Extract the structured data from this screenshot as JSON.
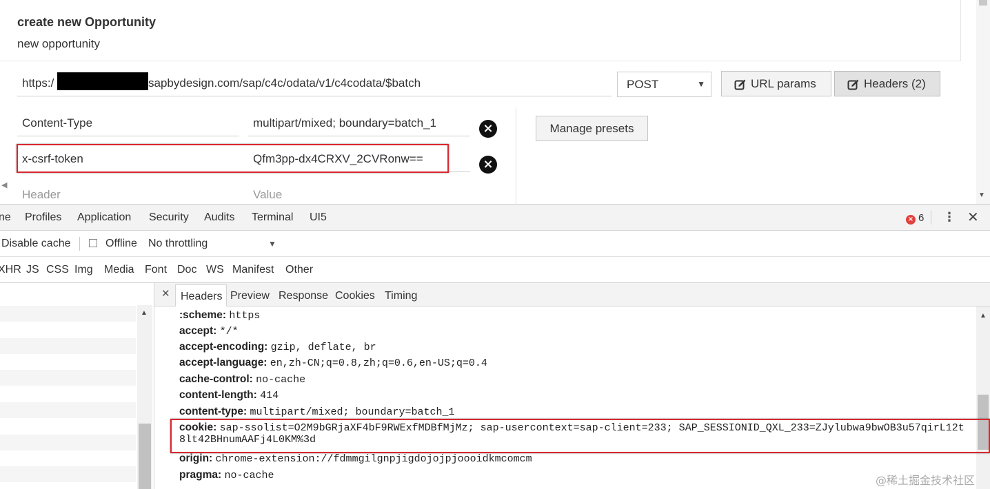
{
  "app": {
    "title": "create new Opportunity",
    "subtitle": "new opportunity",
    "url_prefix": "https:/",
    "url_rest": "sapbydesign.com/sap/c4c/odata/v1/c4codata/$batch",
    "method": "POST",
    "url_params_label": "URL params",
    "headers_button_label": "Headers (2)",
    "manage_presets_label": "Manage presets",
    "headers": [
      {
        "name": "Content-Type",
        "value": "multipart/mixed; boundary=batch_1"
      },
      {
        "name": "x-csrf-token",
        "value": "Qfm3pp-dx4CRXV_2CVRonw=="
      }
    ],
    "header_placeholder": "Header",
    "value_placeholder": "Value"
  },
  "devtools": {
    "tabs": [
      "ne",
      "Profiles",
      "Application",
      "Security",
      "Audits",
      "Terminal",
      "UI5"
    ],
    "error_count": "6",
    "toolbar": {
      "disable_cache": "Disable cache",
      "offline": "Offline",
      "throttling": "No throttling"
    },
    "filters": [
      "XHR",
      "JS",
      "CSS",
      "Img",
      "Media",
      "Font",
      "Doc",
      "WS",
      "Manifest",
      "Other"
    ],
    "detail_tabs": [
      "Headers",
      "Preview",
      "Response",
      "Cookies",
      "Timing"
    ],
    "request_headers": [
      {
        "key": ":scheme:",
        "value": "https"
      },
      {
        "key": "accept:",
        "value": "*/*"
      },
      {
        "key": "accept-encoding:",
        "value": "gzip, deflate, br"
      },
      {
        "key": "accept-language:",
        "value": "en,zh-CN;q=0.8,zh;q=0.6,en-US;q=0.4"
      },
      {
        "key": "cache-control:",
        "value": "no-cache"
      },
      {
        "key": "content-length:",
        "value": "414"
      },
      {
        "key": "content-type:",
        "value": "multipart/mixed; boundary=batch_1"
      },
      {
        "key": "cookie:",
        "value": "sap-ssolist=O2M9bGRjaXF4bF9RWExfMDBfMjMz; sap-usercontext=sap-client=233; SAP_SESSIONID_QXL_233=ZJylubwa9bwOB3u57qirL12t",
        "continuation": "8lt42BHnumAAFj4L0KM%3d"
      },
      {
        "key": "origin:",
        "value": "chrome-extension://fdmmgilgnpjigdojojpjoooidkmcomcm"
      },
      {
        "key": "pragma:",
        "value": "no-cache"
      }
    ]
  },
  "watermark": "@稀土掘金技术社区",
  "colors": {
    "highlight": "#d9272e",
    "error": "#e0413d"
  }
}
